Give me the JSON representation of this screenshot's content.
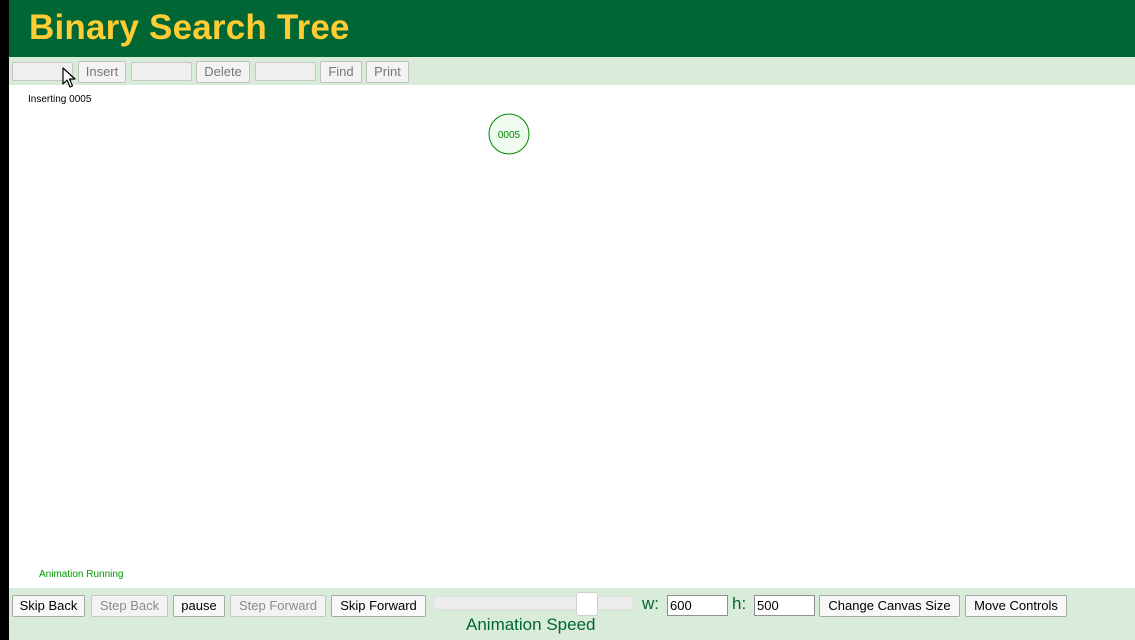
{
  "header": {
    "title": "Binary Search Tree"
  },
  "toolbar": {
    "insert_input_value": "",
    "insert_label": "Insert",
    "delete_input_value": "",
    "delete_label": "Delete",
    "find_input_value": "",
    "find_label": "Find",
    "print_label": "Print"
  },
  "canvas": {
    "message": "Inserting 0005",
    "node_label": "0005",
    "status": "Animation Running"
  },
  "controls": {
    "skip_back": "Skip Back",
    "step_back": "Step Back",
    "pause": "pause",
    "step_forward": "Step Forward",
    "skip_forward": "Skip Forward",
    "speed_level": 0.8,
    "width_label": "w:",
    "width_value": "600",
    "height_label": "h:",
    "height_value": "500",
    "change_canvas_size": "Change Canvas Size",
    "move_controls": "Move Controls",
    "speed_label": "Animation Speed"
  },
  "colors": {
    "header_bg": "#006633",
    "title_color": "#ffcc33",
    "toolbar_bg": "#d9ecd9",
    "node_stroke": "#008800",
    "node_fill": "#eefbee",
    "status_color": "#009900"
  },
  "icons": {
    "cursor": "mouse-pointer-icon"
  }
}
